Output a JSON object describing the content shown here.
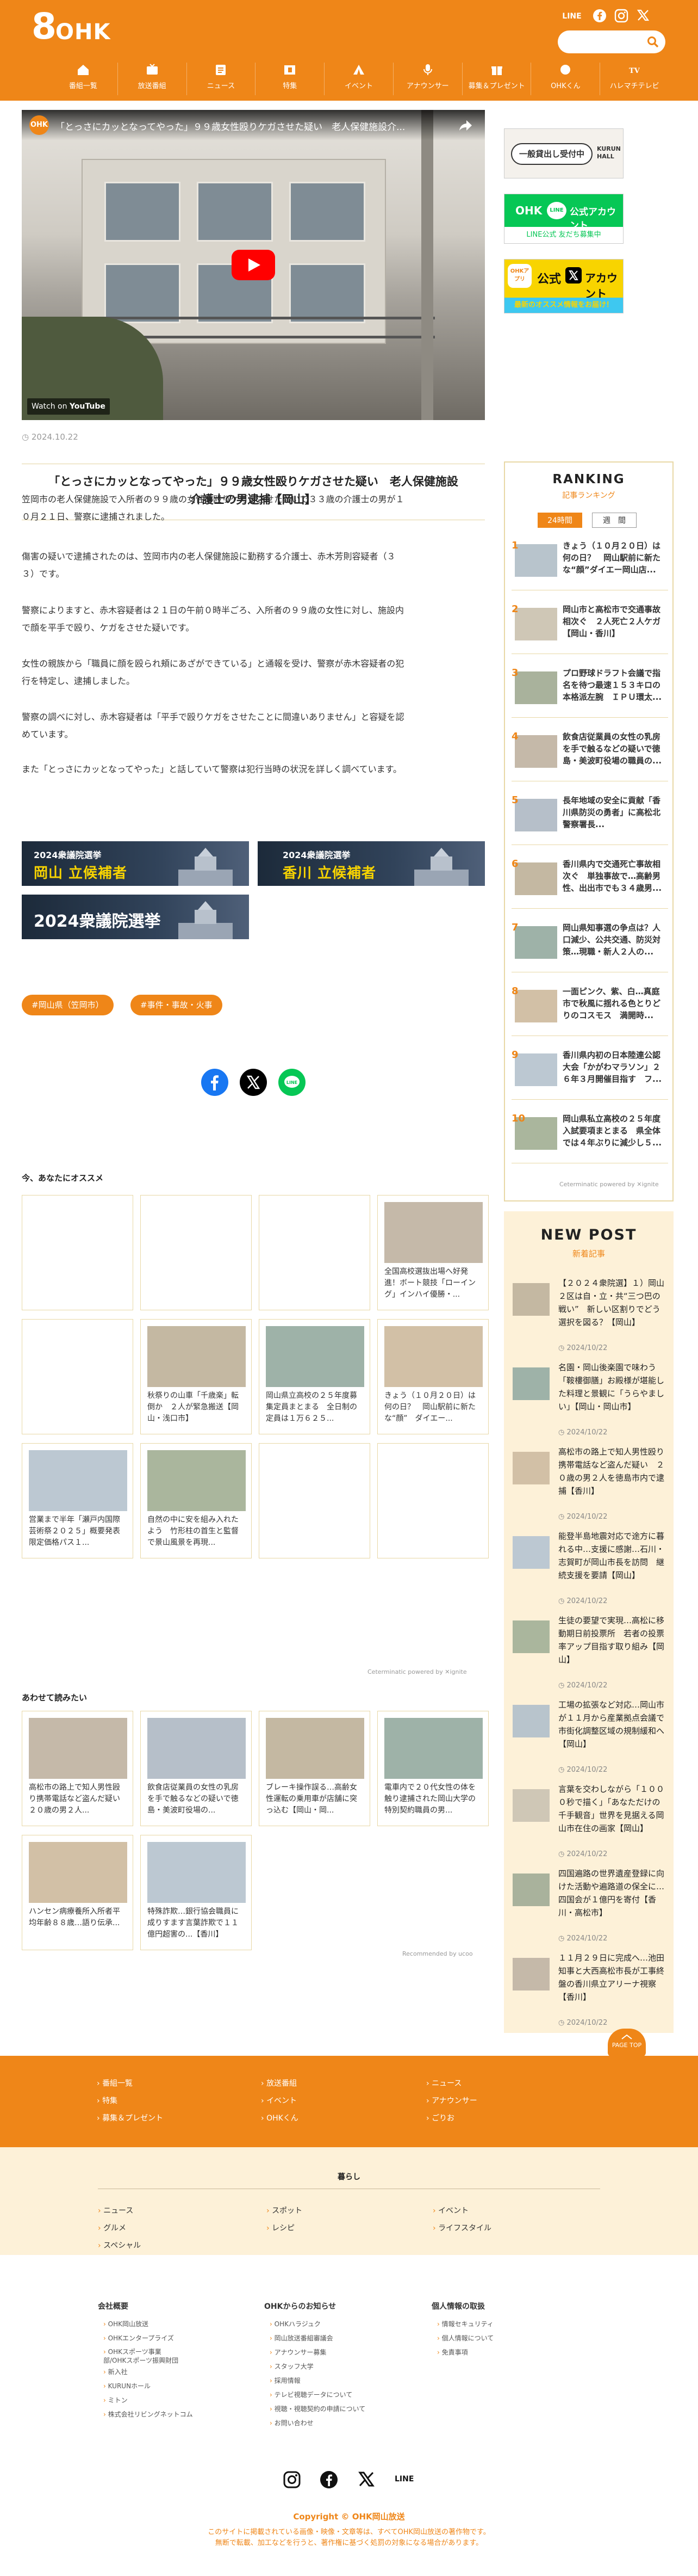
{
  "header": {
    "logo_num": "8",
    "logo_text": "OHK",
    "line": "LINE",
    "nav": [
      "番組一覧",
      "放送番組",
      "ニュース",
      "特集",
      "イベント",
      "アナウンサー",
      "募集＆プレゼント",
      "OHKくん",
      "ハレマチテレビ"
    ]
  },
  "video": {
    "title": "「とっさにカッとなってやった」９９歳女性殴りケガさせた疑い　老人保健施設介...",
    "channel": "OHK",
    "watch_on": "Watch on",
    "youtube": "YouTube"
  },
  "article": {
    "date": "2024.10.22",
    "title_line1": "「とっさにカッとなってやった」９９歳女性殴りケガさせた疑い　老人保健施設",
    "title_line2": "介護士の男逮捕【岡山】",
    "p1": "笠岡市の老人保健施設で入所者の９９歳の女性を殴りケガをさせた疑いで３３歳の介護士の男が１",
    "p1b": "０月２１日、警察に逮捕されました。",
    "p2": "傷害の疑いで逮捕されたのは、笠岡市内の老人保健施設に勤務する介護士、赤木芳則容疑者（３",
    "p2b": "３）です。",
    "p3": "警察によりますと、赤木容疑者は２１日の午前０時半ごろ、入所者の９９歳の女性に対し、施設内",
    "p3b": "で顔を平手で殴り、ケガをさせた疑いです。",
    "p4": "女性の親族から「職員に顔を殴られ頬にあざができている」と通報を受け、警察が赤木容疑者の犯",
    "p4b": "行を特定し、逮捕しました。",
    "p5": "警察の調べに対し、赤木容疑者は「平手で殴りケガをさせたことに間違いありません」と容疑を認",
    "p5b": "めています。",
    "p6": "また「とっさにカッとなってやった」と話していて警察は犯行当時の状況を詳しく調べています。"
  },
  "banners": [
    {
      "tag": "2024衆議院選挙",
      "cand": "岡山 立候補者"
    },
    {
      "tag": "2024衆議院選挙",
      "cand": "香川 立候補者"
    },
    {
      "big": "2024衆議院選挙"
    }
  ],
  "tags": [
    "#岡山県（笠岡市）",
    "#事件・事故・火事"
  ],
  "recommend": {
    "heading": "今、あなたにオススメ",
    "cards": [
      "",
      "",
      "",
      "全国高校選抜出場へ好発進！ボート競技「ローイング」インハイ優勝・...",
      "",
      "秋祭りの山車「千歳楽」転倒か　２人が緊急搬送【岡山・浅口市】",
      "岡山県立高校の２５年度募集定員まとまる　全日制の定員は１万６２５...",
      "きょう（１０月２０日）は何の日？　岡山駅前に新たな“顔”　ダイエー...",
      "営業まで半年「瀬戸内国際芸術祭２０２５」概要発表　限定価格パス１...",
      "自然の中に安を組み入れたよう　竹形柱の首生と監督で景山風景を再現...",
      "",
      ""
    ],
    "powered": "Ceterminatic powered by ✕ignite"
  },
  "also": {
    "heading": "あわせて読みたい",
    "cards": [
      "高松市の路上で知人男性殴り携帯電話など盗んだ疑い　２０歳の男２人...",
      "飲食店従業員の女性の乳房を手で触るなどの疑いで徳島・美波町役場の...",
      "ブレーキ操作誤る…高齢女性運転の乗用車が店舗に突っ込む【岡山・岡...",
      "電車内で２０代女性の体を触り逮捕された岡山大学の特別契約職員の男...",
      "ハンセン病療養所入所者平均年齢８８歳…語り伝承...",
      "特殊詐欺…銀行協会職員に成りすます言葉詐欺で１１億円超害の...【香川】"
    ],
    "powered": "Recommended by ucoo"
  },
  "side": {
    "b1a": "一般貸出し受付中",
    "b1b": "KURUN HALL",
    "b2a": "OHK",
    "b2b": "公式アカウント",
    "b2c": "LINE公式 友だち募集中",
    "b3a": "OHKアプリ",
    "b3b": "公式",
    "b3c": "アカウント",
    "b3d": "最新のオススメ情報をお届け！"
  },
  "ranking": {
    "title": "RANKING",
    "sub": "記事ランキング",
    "tab1": "24時間",
    "tab2": "週　間",
    "items": [
      {
        "num": "1",
        "text": "きょう（１０月２０日）は何の日？　岡山駅前に新たな“顔”ダイエー岡山店..."
      },
      {
        "num": "2",
        "text": "岡山市と高松市で交通事故相次ぐ　２人死亡２人ケガ【岡山・香川】"
      },
      {
        "num": "3",
        "text": "プロ野球ドラフト会議で指名を待つ最速１５３キロの本格派左腕　ＩＰＵ環太..."
      },
      {
        "num": "4",
        "text": "飲食店従業員の女性の乳房を手で触るなどの疑いで徳島・美波町役場の職員の..."
      },
      {
        "num": "5",
        "text": "長年地域の安全に貢献「香川県防災の勇者」に高松北警察署長..."
      },
      {
        "num": "6",
        "text": "香川県内で交通死亡事故相次ぐ　単独事故で…高齢男性、出出市でも３４歳男..."
      },
      {
        "num": "7",
        "text": "岡山県知事選の争点は？人口減少、公共交通、防災対策…現職・新人２人の..."
      },
      {
        "num": "8",
        "text": "一面ピンク、紫、白…真庭市で秋風に揺れる色とりどりのコスモス　満開時..."
      },
      {
        "num": "9",
        "text": "香川県内初の日本陸連公認大会「かがわマラソン」２６年３月開催目指す　フ..."
      },
      {
        "num": "10",
        "text": "岡山県私立高校の２５年度入試要項まとまる　県全体では４年ぶりに減少し５..."
      }
    ],
    "powered": "Ceterminatic powered by ✕ignite"
  },
  "newpost": {
    "title": "NEW POST",
    "sub": "新着記事",
    "items": [
      {
        "text": "【２０２４衆院選】１）岡山２区は自・立・共“三つ巴の戦い”　新しい区割りでどう選択を図る？【岡山】",
        "date": "2024/10/22"
      },
      {
        "text": "名園・岡山後楽園で味わう「鞍樓御膳」お殿様が堪能した料理と景観に「うらやましい」【岡山・岡山市】",
        "date": "2024/10/22"
      },
      {
        "text": "高松市の路上で知人男性殴り携帯電話など盗んだ疑い　２０歳の男２人を徳島市内で逮捕【香川】",
        "date": "2024/10/22"
      },
      {
        "text": "能登半島地震対応で途方に暮れる中…支援に感謝…石川・志賀町が岡山市長を訪問　継続支援を要請【岡山】",
        "date": "2024/10/22"
      },
      {
        "text": "生徒の要望で実現…高松に移動期日前投票所　若者の投票率アップ目指す取り組み【岡山】",
        "date": "2024/10/22"
      },
      {
        "text": "工場の拡張など対応…岡山市が１１月から産業拠点会議で市街化調整区域の規制緩和へ【岡山】",
        "date": "2024/10/22"
      },
      {
        "text": "言葉を交わしながら「１０００秒で描く」「あなただけの千手観音」世界を見据える岡山市在住の画家【岡山】",
        "date": "2024/10/22"
      },
      {
        "text": "四国遍路の世界遺産登録に向けた活動や遍路道の保全に…四国会が１億円を寄付【香川・高松市】",
        "date": "2024/10/22"
      },
      {
        "text": "１１月２９日に完成へ…池田知事と大西高松市長が工事終盤の香川県立アリーナ視察【香川】",
        "date": "2024/10/22"
      }
    ]
  },
  "footer": {
    "pagetop": "PAGE TOP",
    "col1": [
      "番組一覧",
      "特集",
      "募集＆プレゼント"
    ],
    "col2": [
      "放送番組",
      "イベント",
      "OHKくん"
    ],
    "col3": [
      "ニュース",
      "アナウンサー",
      "ごりお"
    ],
    "kurashi": "暮らし",
    "k1": [
      "ニュース",
      "グルメ",
      "スペシャル"
    ],
    "k2": [
      "スポット",
      "レシピ"
    ],
    "k3": [
      "イベント",
      "ライフスタイル"
    ],
    "h1": "会社概要",
    "l1": [
      "OHK岡山放送",
      "OHKエンタープライズ",
      "OHKスポーツ事業部/OHKスポーツ振興財団",
      "新入社",
      "KURUNホール",
      "ミトン",
      "株式会社リビングネットコム"
    ],
    "h2": "OHKからのお知らせ",
    "l2": [
      "OHKハラジュク",
      "岡山放送番組審議会",
      "アナウンサー募集",
      "スタッフ大学",
      "採用情報",
      "テレビ視聴データについて",
      "視聴・視聴契約の申請について",
      "お問い合わせ"
    ],
    "h3": "個人情報の取扱",
    "l3": [
      "情報セキュリティ",
      "個人情報について",
      "免責事項"
    ],
    "line": "LINE",
    "copyright": "Copyright © OHK岡山放送",
    "notice1": "このサイトに掲載されている画像・映像・文章等は、すべてOHK岡山放送の著作物です。",
    "notice2": "無断で転載、加工などを行うと、著作権に基づく処罰の対象になる場合があります。"
  },
  "colors": {
    "accent": "#ef8618",
    "cream": "#fdf1d8",
    "gold": "#e8d8a6"
  }
}
